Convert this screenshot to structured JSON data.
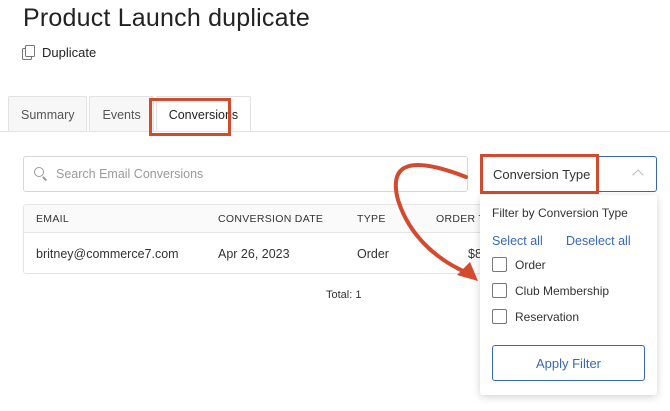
{
  "page": {
    "title": "Product Launch duplicate",
    "duplicate_label": "Duplicate"
  },
  "tabs": [
    {
      "label": "Summary",
      "active": false
    },
    {
      "label": "Events",
      "active": false
    },
    {
      "label": "Conversions",
      "active": true
    }
  ],
  "search": {
    "placeholder": "Search Email Conversions"
  },
  "table": {
    "headers": [
      "EMAIL",
      "CONVERSION DATE",
      "TYPE",
      "ORDER T"
    ],
    "rows": [
      {
        "email": "britney@commerce7.com",
        "date": "Apr 26, 2023",
        "type": "Order",
        "order_total": "$8"
      }
    ],
    "total_label": "Total: 1"
  },
  "filter": {
    "button_label": "Conversion Type",
    "heading": "Filter by Conversion Type",
    "select_all": "Select all",
    "deselect_all": "Deselect all",
    "options": [
      {
        "label": "Order",
        "checked": false
      },
      {
        "label": "Club Membership",
        "checked": false
      },
      {
        "label": "Reservation",
        "checked": false
      }
    ],
    "apply_label": "Apply Filter"
  },
  "colors": {
    "annotation": "#d24a30",
    "accent": "#3a68b7"
  },
  "icons": {
    "duplicate": "duplicate-icon",
    "search": "search-icon",
    "chevron": "chevron-up-icon"
  }
}
